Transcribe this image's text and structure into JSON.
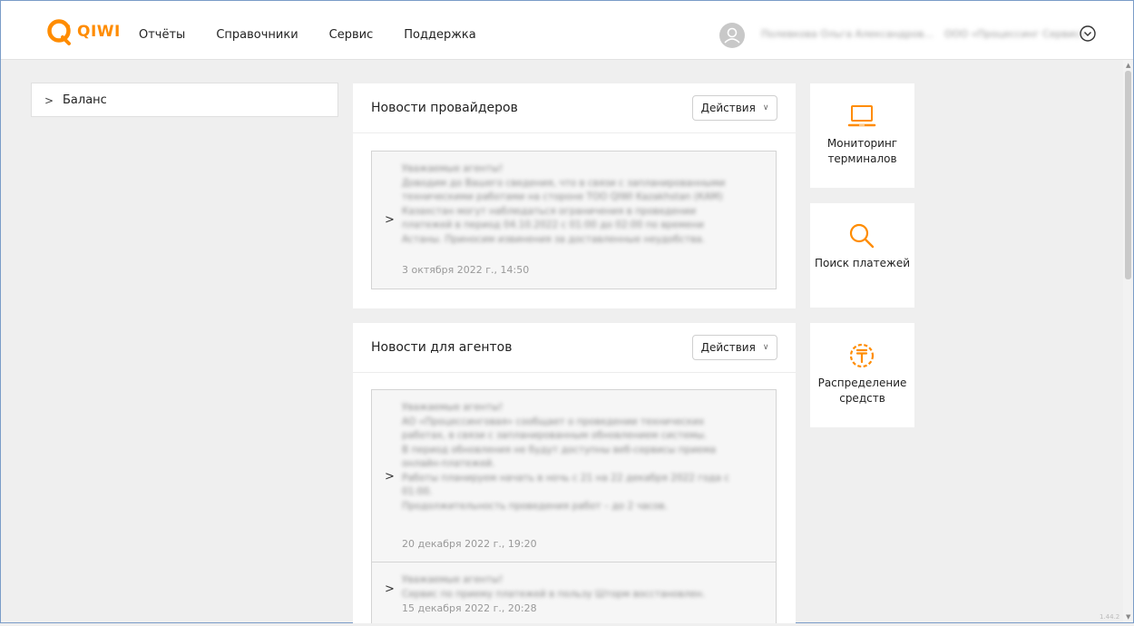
{
  "header": {
    "brand": "QIWI",
    "nav": [
      "Отчёты",
      "Справочники",
      "Сервис",
      "Поддержка"
    ],
    "user_name": "Полевкова Ольга Александров...",
    "user_org": "ООО «Процессинг Сервис»"
  },
  "balance": {
    "label": "Баланс"
  },
  "provider_news": {
    "title": "Новости провайдеров",
    "actions_label": "Действия",
    "items": [
      {
        "lines": [
          "Уважаемые агенты!",
          "Доводим до Вашего сведения, что в связи с запланированными",
          "техническими работами на стороне ТОО QIWI Kazakhstan (КАМ)",
          "Казахстан могут наблюдаться ограничения в проведении",
          "платежей в период 04.10.2022 с 01:00 до 02:00 по времени",
          "Астаны. Приносим извинения за доставленные неудобства."
        ],
        "date": "3 октября 2022 г., 14:50"
      }
    ]
  },
  "agent_news": {
    "title": "Новости для агентов",
    "actions_label": "Действия",
    "items": [
      {
        "lines": [
          "Уважаемые агенты!",
          "АО «Процессинговая» сообщает о проведении технических",
          "работах, в связи с запланированным обновлением системы.",
          "В период обновления не будут доступны веб-сервисы приема",
          "онлайн-платежей.",
          "Работы планируем начать в ночь с 21 на 22 декабря 2022 года с",
          "01:00.",
          "Продолжительность проведения работ – до 2 часов."
        ],
        "date": "20 декабря 2022 г., 19:20"
      },
      {
        "lines": [
          "Уважаемые агенты!",
          "Сервис по приему платежей в пользу Шторм восстановлен."
        ],
        "date": "15 декабря 2022 г., 20:28"
      }
    ]
  },
  "tiles": [
    {
      "icon": "laptop-icon",
      "label": "Мониторинг терминалов"
    },
    {
      "icon": "search-icon",
      "label": "Поиск платежей"
    },
    {
      "icon": "tenge-coin-icon",
      "label": "Распределение средств"
    }
  ],
  "version": "1.44.2",
  "colors": {
    "brand": "#ff8c00",
    "background": "#efefef",
    "card": "#ffffff"
  }
}
